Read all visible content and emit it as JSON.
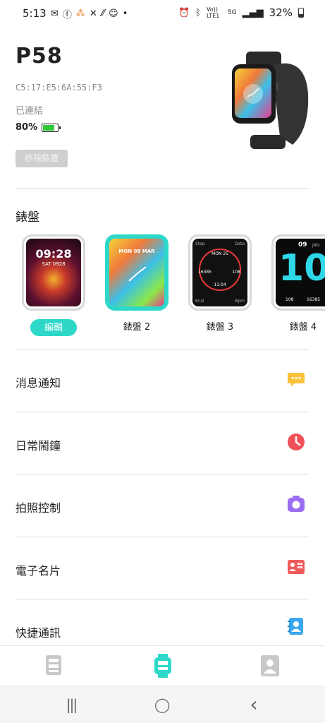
{
  "status_bar": {
    "time": "5:13",
    "left_icons": [
      "gmail-icon",
      "facebook-icon",
      "app-icon",
      "xcode-icon",
      "signal-dots-icon",
      "app-circle-icon",
      "dot-icon"
    ],
    "right_icons": [
      "alarm-icon",
      "bluetooth-icon",
      "volte-icon",
      "5g-icon",
      "signal-icon"
    ],
    "volte_label": "Vo)) LTE1",
    "network_label": "5G",
    "battery": "32%"
  },
  "device": {
    "name": "P58",
    "mac": "C5:17:E5:6A:55:F3",
    "status": "已連結",
    "battery": "80%",
    "battery_level": 0.8,
    "remove_label": "移除裝置"
  },
  "faces_section": {
    "title": "錶盤",
    "faces": [
      {
        "label": "編輯",
        "time": "09:28",
        "date": "SAT 0928",
        "is_current": true
      },
      {
        "label": "錶盤 2",
        "date": "MON 08 MAR",
        "selected": true
      },
      {
        "label": "錶盤 3",
        "top_left": "Step",
        "top_right": "Data",
        "center_top": "MON 25",
        "left": "16385",
        "right": "108",
        "center_bottom": "11:04",
        "bottom_left": "Kcal",
        "bottom_right": "Bpm"
      },
      {
        "label": "錶盤 4",
        "time": "10",
        "day": "09",
        "month": "JAN",
        "left_val": "108",
        "right_val": "16385"
      }
    ]
  },
  "menu": [
    {
      "label": "消息通知",
      "icon": "message-icon",
      "color": "#f8c23a"
    },
    {
      "label": "日常鬧鐘",
      "icon": "clock-icon",
      "color": "#f0505a"
    },
    {
      "label": "拍照控制",
      "icon": "camera-icon",
      "color": "#9a6ef0"
    },
    {
      "label": "電子名片",
      "icon": "business-card-icon",
      "color": "#f05a5a"
    },
    {
      "label": "快捷通訊",
      "icon": "contacts-icon",
      "color": "#3aa8f0"
    }
  ],
  "bottom_nav": {
    "items": [
      "home-icon",
      "watch-icon",
      "profile-icon"
    ],
    "active_color": "#2ed8c8",
    "inactive_color": "#c8c8c8"
  },
  "system_nav": {
    "recents": "|||",
    "home": "◯",
    "back": "‹"
  }
}
